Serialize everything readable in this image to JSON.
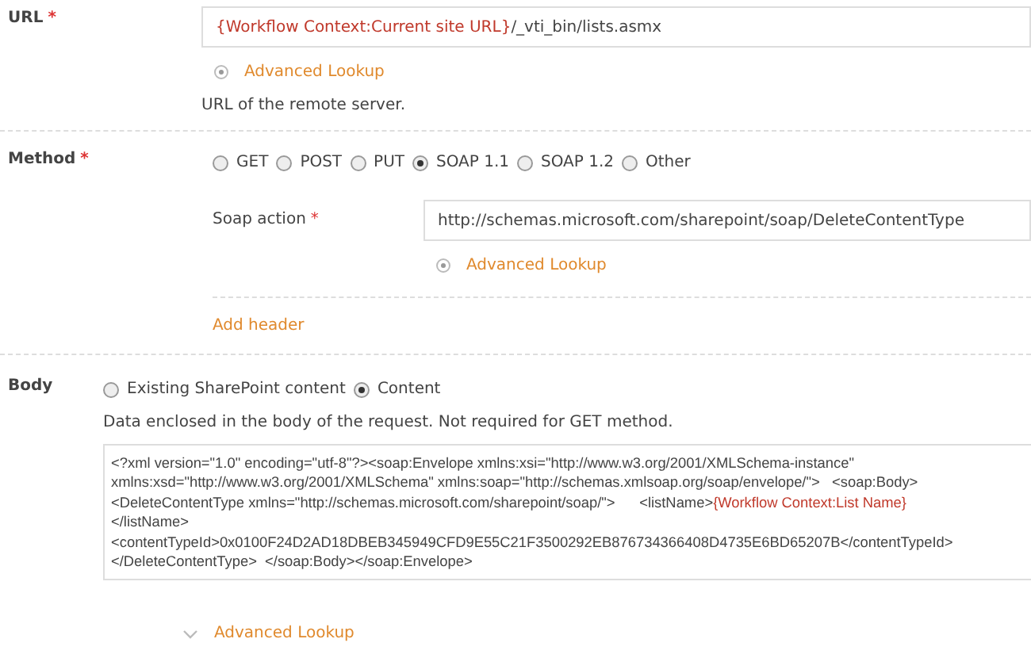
{
  "url": {
    "label": "URL",
    "required_mark": "*",
    "value": [
      {
        "kind": "variable",
        "text": "{Workflow Context:Current site URL}"
      },
      {
        "kind": "text",
        "text": "/_vti_bin/lists.asmx"
      }
    ],
    "lookup": "Advanced Lookup",
    "help": "URL of the remote server."
  },
  "method": {
    "label": "Method",
    "required_mark": "*",
    "options": [
      {
        "label": "GET",
        "selected": false
      },
      {
        "label": "POST",
        "selected": false
      },
      {
        "label": "PUT",
        "selected": false
      },
      {
        "label": "SOAP 1.1",
        "selected": true
      },
      {
        "label": "SOAP 1.2",
        "selected": false
      },
      {
        "label": "Other",
        "selected": false
      }
    ],
    "soap_action": {
      "label": "Soap action",
      "required_mark": "*",
      "value": "http://schemas.microsoft.com/sharepoint/soap/DeleteContentType",
      "lookup": "Advanced Lookup"
    },
    "add_header": "Add header"
  },
  "body": {
    "label": "Body",
    "options": [
      {
        "label": "Existing SharePoint content",
        "selected": false
      },
      {
        "label": "Content",
        "selected": true
      }
    ],
    "help": "Data enclosed in the body of the request. Not required for GET method.",
    "content_lines": [
      [
        {
          "kind": "text",
          "text": "<?xml version=\"1.0\" encoding=\"utf-8\"?><soap:Envelope xmlns:xsi=\"http://www.w3.org/2001/XMLSchema-instance\""
        }
      ],
      [
        {
          "kind": "text",
          "text": "xmlns:xsd=\"http://www.w3.org/2001/XMLSchema\" xmlns:soap=\"http://schemas.xmlsoap.org/soap/envelope/\">   <soap:Body>"
        }
      ],
      [
        {
          "kind": "text",
          "text": "<DeleteContentType xmlns=\"http://schemas.microsoft.com/sharepoint/soap/\">      <listName>"
        },
        {
          "kind": "variable",
          "text": "{Workflow Context:List Name}"
        }
      ],
      [
        {
          "kind": "text",
          "text": "</listName>"
        }
      ],
      [
        {
          "kind": "text",
          "text": "<contentTypeId>0x0100F24D2AD18DBEB345949CFD9E55C21F3500292EB876734366408D4735E6BD65207B</contentTypeId>"
        }
      ],
      [
        {
          "kind": "text",
          "text": "</DeleteContentType>  </soap:Body></soap:Envelope>"
        }
      ]
    ],
    "lookup": "Advanced Lookup"
  }
}
